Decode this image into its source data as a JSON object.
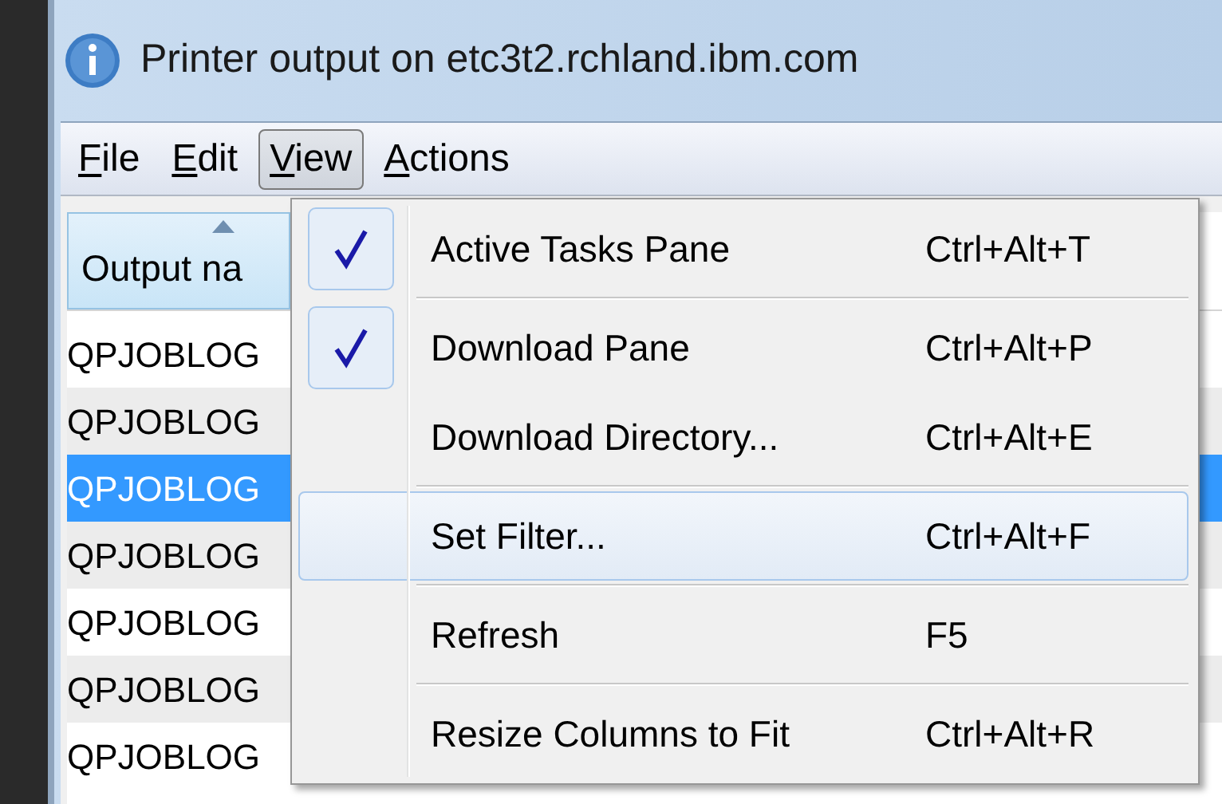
{
  "window": {
    "title": "Printer output on etc3t2.rchland.ibm.com"
  },
  "menu_bar": [
    {
      "label": "File",
      "selected": false
    },
    {
      "label": "Edit",
      "selected": false
    },
    {
      "label": "View",
      "selected": true
    },
    {
      "label": "Actions",
      "selected": false
    }
  ],
  "table": {
    "columns": [
      {
        "label": "Output na",
        "sorted": true
      }
    ],
    "rows": [
      {
        "cells": [
          "QPJOBLOG"
        ],
        "selected": false
      },
      {
        "cells": [
          "QPJOBLOG"
        ],
        "selected": false
      },
      {
        "cells": [
          "QPJOBLOG"
        ],
        "selected": true
      },
      {
        "cells": [
          "QPJOBLOG"
        ],
        "selected": false
      },
      {
        "cells": [
          "QPJOBLOG"
        ],
        "selected": false
      },
      {
        "cells": [
          "QPJOBLOG"
        ],
        "selected": false
      },
      {
        "cells": [
          "QPJOBLOG"
        ],
        "selected": false
      }
    ]
  },
  "view_menu": {
    "groups": [
      {
        "items": [
          {
            "label": "Active Tasks Pane",
            "shortcut": "Ctrl+Alt+T",
            "checked": true,
            "selected": false
          }
        ]
      },
      {
        "items": [
          {
            "label": "Download Pane",
            "shortcut": "Ctrl+Alt+P",
            "checked": true,
            "selected": false
          },
          {
            "label": "Download Directory...",
            "shortcut": "Ctrl+Alt+E",
            "checked": false,
            "selected": false
          }
        ]
      },
      {
        "items": [
          {
            "label": "Set Filter...",
            "shortcut": "Ctrl+Alt+F",
            "checked": false,
            "selected": true
          }
        ]
      },
      {
        "items": [
          {
            "label": "Refresh",
            "shortcut": "F5",
            "checked": false,
            "selected": false
          }
        ]
      },
      {
        "items": [
          {
            "label": "Resize Columns to Fit",
            "shortcut": "Ctrl+Alt+R",
            "checked": false,
            "selected": false
          }
        ]
      }
    ]
  }
}
